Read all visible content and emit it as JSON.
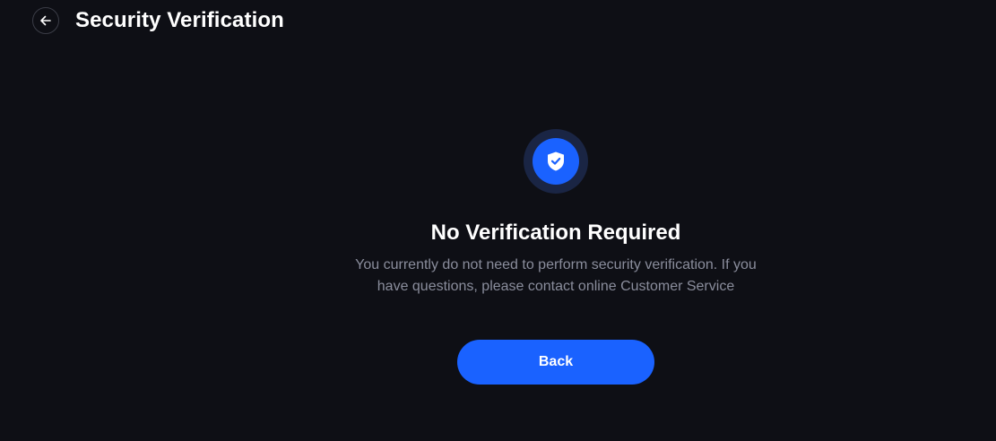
{
  "header": {
    "title": "Security Verification",
    "back_icon": "arrow-left-icon"
  },
  "status": {
    "icon": "shield-check-icon",
    "title": "No Verification Required",
    "description": "You currently do not need to perform security verification. If you have questions, please contact online Customer Service"
  },
  "actions": {
    "back_label": "Back"
  },
  "colors": {
    "background": "#0e0f15",
    "accent": "#1a62ff",
    "icon_ring": "#1a2544",
    "muted_text": "#8a8d9c"
  }
}
